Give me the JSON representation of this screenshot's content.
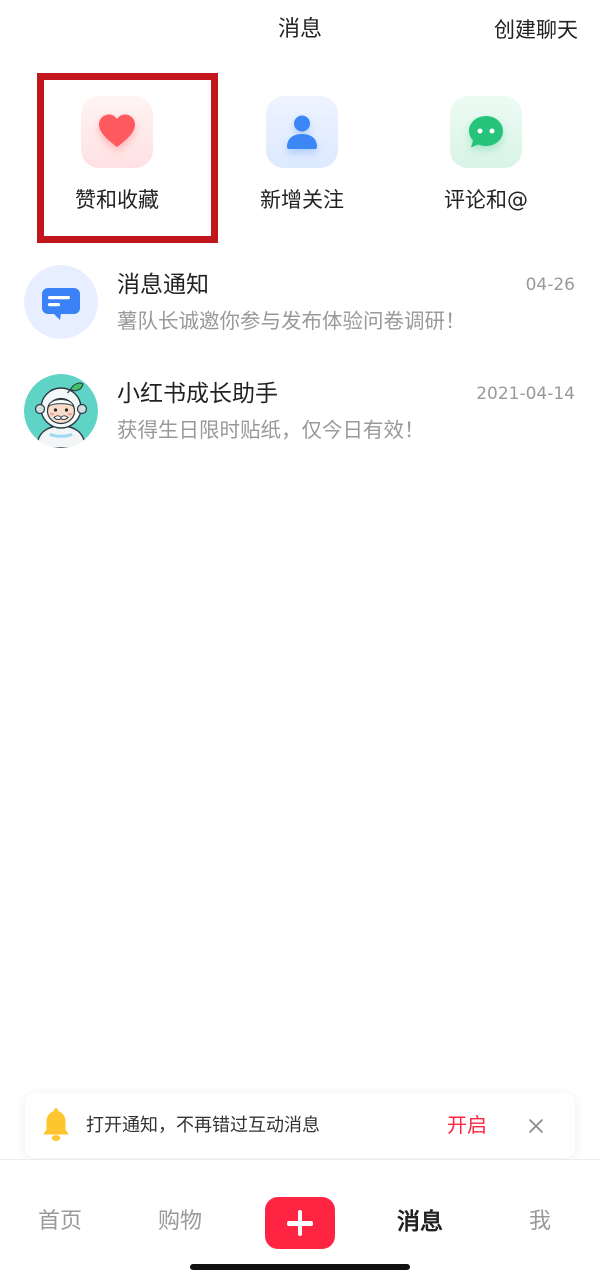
{
  "header": {
    "title": "消息",
    "create_chat_label": "创建聊天"
  },
  "categories": [
    {
      "label": "赞和收藏",
      "icon": "heart-icon"
    },
    {
      "label": "新增关注",
      "icon": "person-icon"
    },
    {
      "label": "评论和@",
      "icon": "chat-bubble-icon"
    }
  ],
  "messages": [
    {
      "title": "消息通知",
      "date": "04-26",
      "preview": "薯队长诚邀你参与发布体验问卷调研！",
      "avatar": "notification-icon"
    },
    {
      "title": "小红书成长助手",
      "date": "2021-04-14",
      "preview": "获得生日限时贴纸，仅今日有效！",
      "avatar": "astronaut-avatar"
    }
  ],
  "notice_banner": {
    "icon": "bell-icon",
    "text": "打开通知，不再错过互动消息",
    "action_label": "开启",
    "close_icon": "close-icon"
  },
  "tabbar": {
    "items": [
      {
        "label": "首页"
      },
      {
        "label": "购物"
      },
      {
        "icon": "plus-icon"
      },
      {
        "label": "消息",
        "active": true
      },
      {
        "label": "我"
      }
    ]
  },
  "colors": {
    "accent": "#ff2442",
    "highlight_box": "#c0161c",
    "heart": "#ff5a60",
    "follow": "#3d86f6",
    "comment": "#26c37a",
    "primary_text": "#222222",
    "muted_text": "#999999",
    "tab_inactive": "#999999"
  }
}
